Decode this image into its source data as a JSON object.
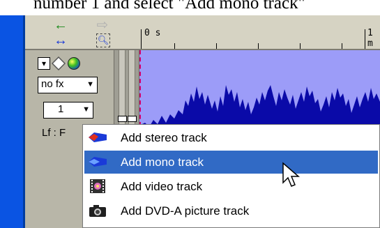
{
  "caption": "number 1 and select \"Add mono track\"",
  "ruler": {
    "label_0": "0 s",
    "label_1": "1 m"
  },
  "track": {
    "fx_label": "no fx",
    "number_label": "1",
    "lf_label": "Lf : F"
  },
  "menu": {
    "items": [
      {
        "label": "Add stereo track",
        "icon": "stereo-waveform-icon"
      },
      {
        "label": "Add mono track",
        "icon": "mono-waveform-icon",
        "active": true
      },
      {
        "label": "Add video track",
        "icon": "video-film-icon"
      },
      {
        "label": "Add DVD-A picture track",
        "icon": "camera-icon"
      }
    ]
  },
  "colors": {
    "selection": "#316ac5",
    "waveform": "#0a0aa8",
    "waveform_bg": "#9c9cf8",
    "xp_blue": "#0a54e3"
  }
}
